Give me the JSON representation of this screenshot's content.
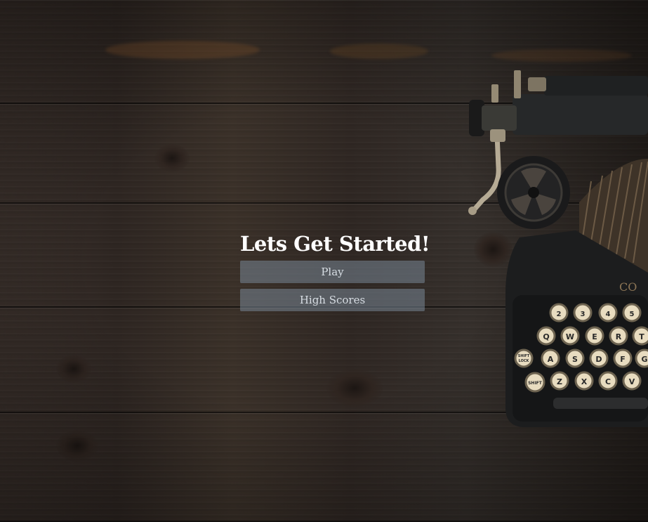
{
  "menu": {
    "title": "Lets Get Started!",
    "play_label": "Play",
    "high_scores_label": "High Scores"
  },
  "typewriter_keys": {
    "row1": [
      "2",
      "3",
      "4",
      "5"
    ],
    "row2": [
      "Q",
      "W",
      "E",
      "R",
      "T"
    ],
    "row3": [
      "SHIFT LOCK",
      "A",
      "S",
      "D",
      "F",
      "G"
    ],
    "row4": [
      "SHIFT",
      "Z",
      "X",
      "C",
      "V"
    ]
  },
  "background": {
    "description_icon": "wood-planks",
    "accent_colors": {
      "wood_dark": "#2b2420",
      "button_fill": "#6c7886",
      "key_cap": "#e8dcc0"
    }
  }
}
